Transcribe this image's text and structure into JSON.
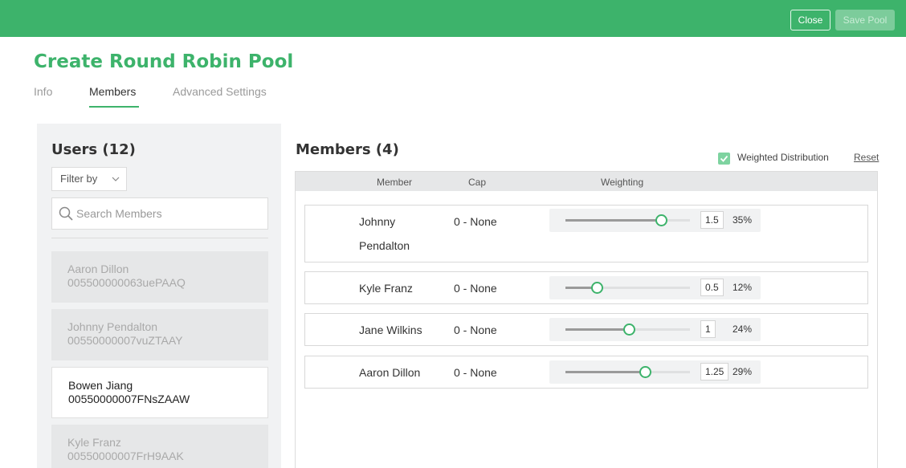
{
  "header": {
    "close_label": "Close",
    "save_label": "Save Pool",
    "accent": "#3db36b"
  },
  "page": {
    "title": "Create Round Robin Pool"
  },
  "tabs": [
    {
      "label": "Info",
      "active": false
    },
    {
      "label": "Members",
      "active": true
    },
    {
      "label": "Advanced Settings",
      "active": false
    }
  ],
  "users_panel": {
    "title": "Users (12)",
    "filter_label": "Filter by",
    "search_placeholder": "Search Members",
    "users": [
      {
        "name": "Aaron Dillon",
        "id": "005500000063uePAAQ",
        "active": false
      },
      {
        "name": "Johnny Pendalton",
        "id": "00550000007vuZTAAY",
        "active": false
      },
      {
        "name": "Bowen Jiang",
        "id": "00550000007FNsZAAW",
        "active": true
      },
      {
        "name": "Kyle Franz",
        "id": "00550000007FrH9AAK",
        "active": false
      }
    ]
  },
  "members_panel": {
    "title": "Members (4)",
    "weighted_label": "Weighted Distribution",
    "weighted_checked": true,
    "reset_label": "Reset",
    "columns": {
      "member": "Member",
      "cap": "Cap",
      "weighting": "Weighting"
    },
    "members": [
      {
        "name_line1": "Johnny",
        "name_line2": "Pendalton",
        "cap": "0 - None",
        "weight": "1.5",
        "percent": "35%",
        "slider_level": 0.77
      },
      {
        "name_line1": "Kyle Franz",
        "name_line2": "",
        "cap": "0 - None",
        "weight": "0.5",
        "percent": "12%",
        "slider_level": 0.25
      },
      {
        "name_line1": "Jane Wilkins",
        "name_line2": "",
        "cap": "0 - None",
        "weight": "1",
        "percent": "24%",
        "slider_level": 0.51
      },
      {
        "name_line1": "Aaron Dillon",
        "name_line2": "",
        "cap": "0 - None",
        "weight": "1.25",
        "percent": "29%",
        "slider_level": 0.64
      }
    ]
  }
}
